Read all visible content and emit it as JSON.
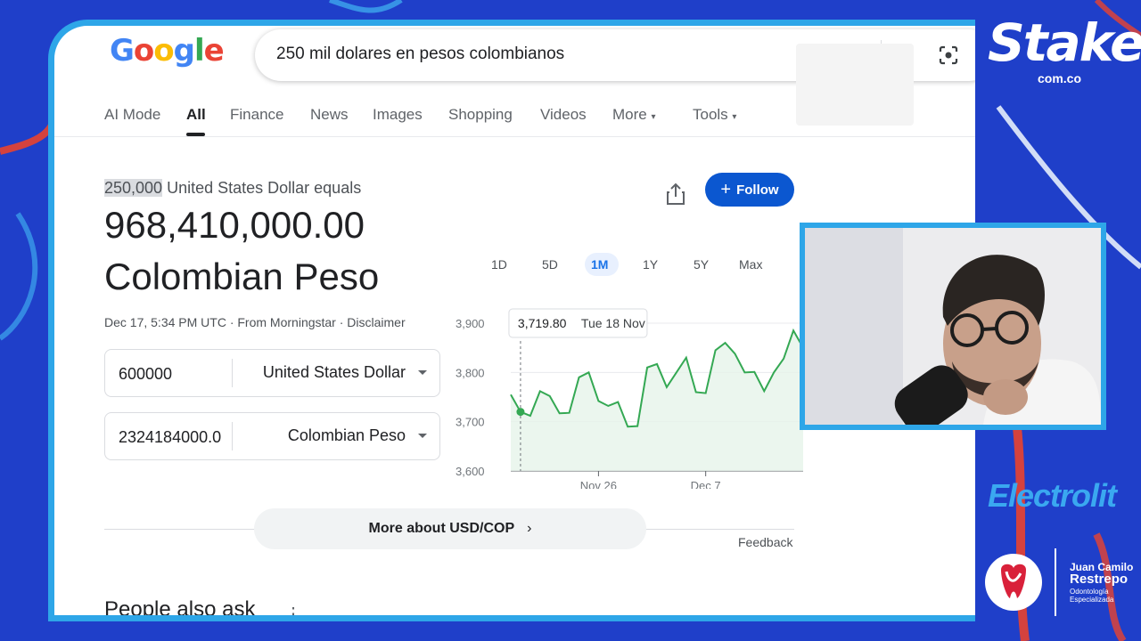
{
  "search": {
    "query": "250 mil dolares en pesos colombianos",
    "logo": "Google"
  },
  "tabs": [
    "AI Mode",
    "All",
    "Finance",
    "News",
    "Images",
    "Shopping",
    "Videos",
    "More",
    "Tools"
  ],
  "active_tab": "All",
  "result": {
    "amount_highlight": "250,000",
    "equals_text": " United States Dollar equals",
    "value": "968,410,000.00",
    "currency": "Colombian Peso",
    "meta": "Dec 17, 5:34 PM UTC · From Morningstar · Disclaimer"
  },
  "converter": {
    "from_amount": "600000",
    "from_unit": "United States Dollar",
    "to_amount": "2324184000.0",
    "to_unit": "Colombian Peso"
  },
  "follow_label": "Follow",
  "ranges": [
    "1D",
    "5D",
    "1M",
    "1Y",
    "5Y",
    "Max"
  ],
  "active_range": "1M",
  "tooltip": {
    "value": "3,719.80",
    "date": "Tue 18 Nov"
  },
  "chart_data": {
    "type": "area",
    "ylim": [
      3600,
      3900
    ],
    "y_ticks": [
      "3,900",
      "3,800",
      "3,700",
      "3,600"
    ],
    "x_ticks": [
      "Nov 26",
      "Dec 7"
    ],
    "x": [
      "Nov 17",
      "Nov 18",
      "Nov 19",
      "Nov 20",
      "Nov 21",
      "Nov 22",
      "Nov 23",
      "Nov 24",
      "Nov 25",
      "Nov 26",
      "Nov 27",
      "Nov 28",
      "Nov 29",
      "Nov 30",
      "Dec 1",
      "Dec 2",
      "Dec 3",
      "Dec 4",
      "Dec 5",
      "Dec 6",
      "Dec 7",
      "Dec 8",
      "Dec 9",
      "Dec 10",
      "Dec 11",
      "Dec 12",
      "Dec 13",
      "Dec 14",
      "Dec 15",
      "Dec 16",
      "Dec 17"
    ],
    "values": [
      3755,
      3720,
      3712,
      3762,
      3752,
      3717,
      3718,
      3790,
      3800,
      3742,
      3732,
      3740,
      3690,
      3691,
      3810,
      3817,
      3770,
      3800,
      3830,
      3760,
      3758,
      3845,
      3860,
      3838,
      3800,
      3801,
      3762,
      3800,
      3828,
      3885,
      3850
    ],
    "colors": {
      "line": "#34a853",
      "fill": "#e6f4ea",
      "grid": "#e8eaed"
    }
  },
  "more_about": "More about USD/COP",
  "feedback": "Feedback",
  "people_also_ask": "People also ask",
  "overlay": {
    "brand1": "Stake",
    "brand1_sub": "com.co",
    "brand2": "Electrolit",
    "doctor_first": "Juan Camilo",
    "doctor_last": "Restrepo",
    "doctor_spec1": "Odontología",
    "doctor_spec2": "Especializada"
  }
}
